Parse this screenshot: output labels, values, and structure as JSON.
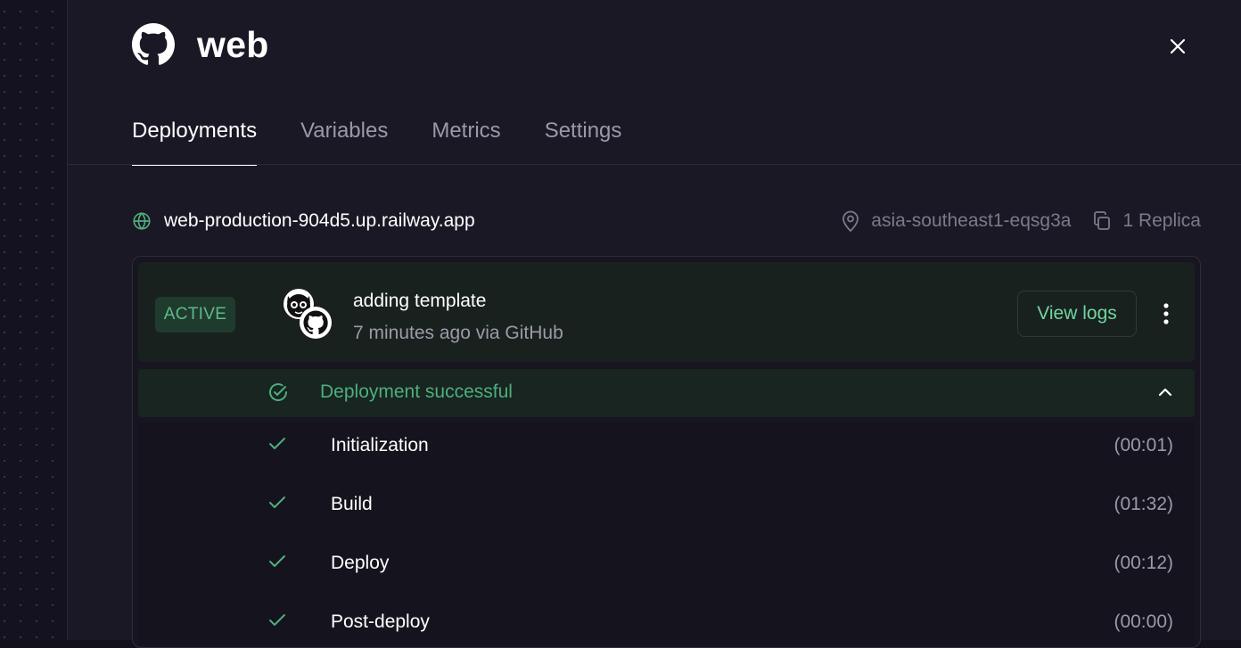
{
  "service": {
    "name": "web",
    "icon": "github-icon"
  },
  "tabs": [
    {
      "label": "Deployments",
      "active": true
    },
    {
      "label": "Variables",
      "active": false
    },
    {
      "label": "Metrics",
      "active": false
    },
    {
      "label": "Settings",
      "active": false
    }
  ],
  "domain": {
    "url": "web-production-904d5.up.railway.app",
    "icon": "globe-icon"
  },
  "region": {
    "label": "asia-southeast1-eqsg3a",
    "icon": "map-pin-icon"
  },
  "replicas": {
    "label": "1 Replica",
    "icon": "copy-icon"
  },
  "deployment": {
    "status_badge": "ACTIVE",
    "commit_message": "adding template",
    "meta": "7 minutes ago via GitHub",
    "view_logs_label": "View logs",
    "result_text": "Deployment successful",
    "steps": [
      {
        "name": "Initialization",
        "duration": "(00:01)"
      },
      {
        "name": "Build",
        "duration": "(01:32)"
      },
      {
        "name": "Deploy",
        "duration": "(00:12)"
      },
      {
        "name": "Post-deploy",
        "duration": "(00:00)"
      }
    ]
  },
  "colors": {
    "background": "#1a1825",
    "active_badge_bg": "#1f3b2e",
    "success_green": "#4fae7c",
    "accent_green": "#6fd6a0",
    "muted_text": "#9c9aa8"
  }
}
